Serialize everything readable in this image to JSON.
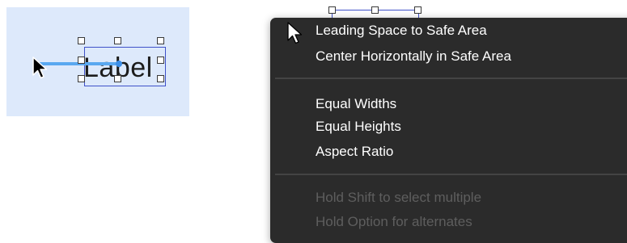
{
  "canvas": {
    "label_text": "Label",
    "background_color": "#dde9fb",
    "constraint_color": "#5aa8f0",
    "selection_color": "#3f51c9"
  },
  "context_menu": {
    "group1": [
      "Leading Space to Safe Area",
      "Center Horizontally in Safe Area"
    ],
    "group2": [
      "Equal Widths",
      "Equal Heights",
      "Aspect Ratio"
    ],
    "hints": [
      "Hold Shift to select multiple",
      "Hold Option for alternates"
    ],
    "background_color": "#2b2b2b"
  },
  "cursors": [
    "arrow-cursor-icon",
    "arrow-cursor-icon"
  ]
}
